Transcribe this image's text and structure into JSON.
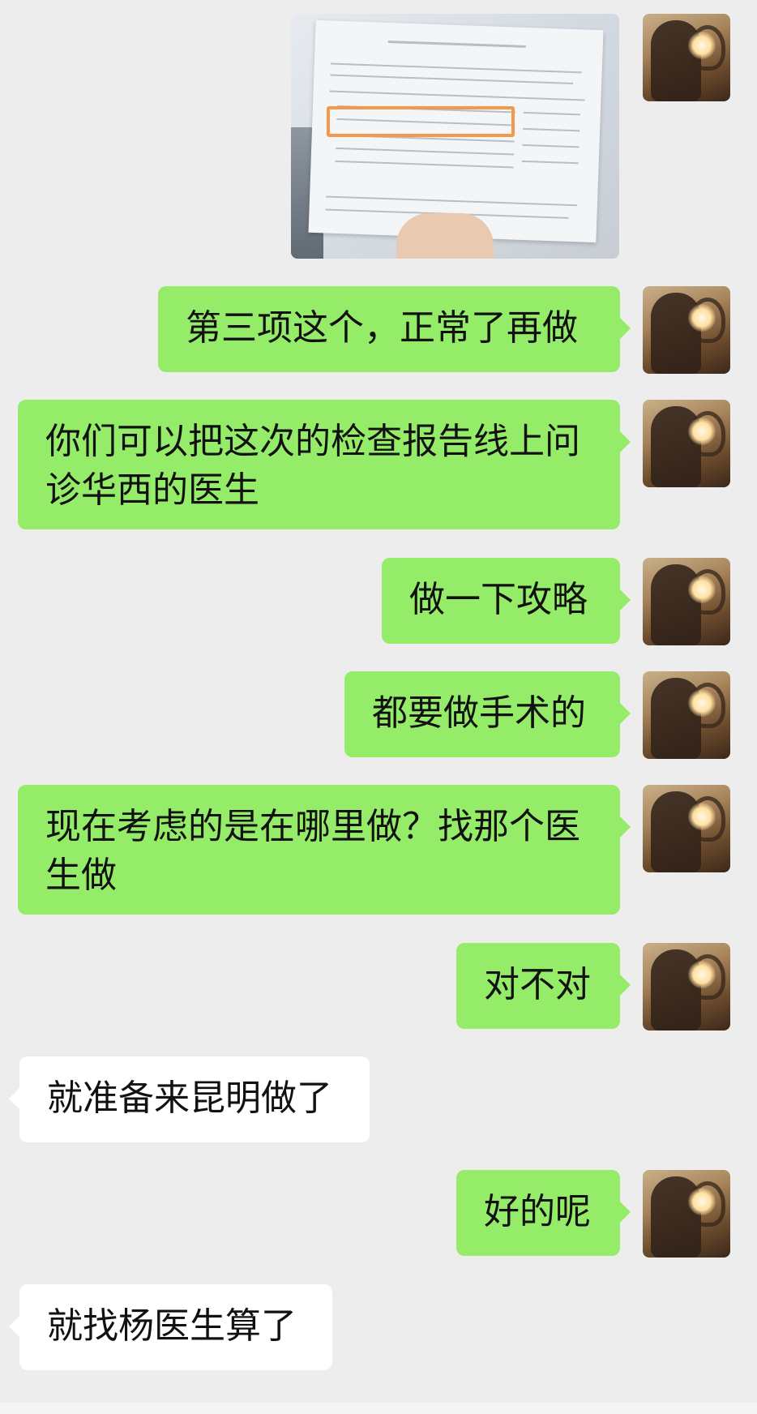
{
  "messages": [
    {
      "sender": "me",
      "type": "image"
    },
    {
      "sender": "me",
      "type": "text",
      "text": "第三项这个，正常了再做"
    },
    {
      "sender": "me",
      "type": "text",
      "text": "你们可以把这次的检查报告线上问诊华西的医生"
    },
    {
      "sender": "me",
      "type": "text",
      "text": "做一下攻略"
    },
    {
      "sender": "me",
      "type": "text",
      "text": "都要做手术的"
    },
    {
      "sender": "me",
      "type": "text",
      "text": "现在考虑的是在哪里做？找那个医生做"
    },
    {
      "sender": "me",
      "type": "text",
      "text": "对不对"
    },
    {
      "sender": "other",
      "type": "text",
      "text": "就准备来昆明做了"
    },
    {
      "sender": "me",
      "type": "text",
      "text": "好的呢"
    },
    {
      "sender": "other",
      "type": "text",
      "text": "就找杨医生算了"
    }
  ],
  "colors": {
    "background": "#ededed",
    "my_bubble": "#95ec69",
    "other_bubble": "#ffffff",
    "report_highlight": "#f29a4a"
  }
}
